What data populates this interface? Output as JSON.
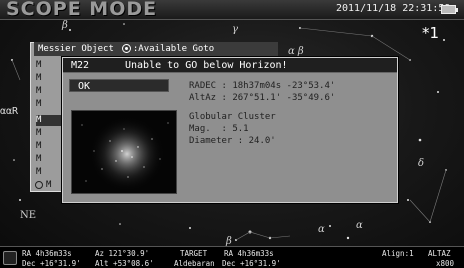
{
  "header": {
    "mode_title": "SCOPE MODE",
    "clock": "2011/11/18 22:31:59"
  },
  "corner_note": "*1",
  "side_marker": "ααR",
  "sky_labels": [
    "β",
    "α β",
    "γ",
    "δ",
    "α",
    "NE",
    "α",
    "β"
  ],
  "list_panel": {
    "title": "Messier Object",
    "goto_hint": ":Available Goto",
    "rows": [
      "M",
      "M",
      "M",
      "M",
      "M",
      "M",
      "M",
      "M",
      "M",
      "M",
      "M"
    ]
  },
  "dialog": {
    "object": "M22",
    "message": "Unable to GO below Horizon!",
    "ok_label": "OK",
    "radec": "RADEC : 18h37m04s -23°53.4'",
    "altaz": "AltAz : 267°51.1' -35°49.6'",
    "type": "Globular Cluster",
    "mag": "Mag.  : 5.1",
    "diameter": "Diameter : 24.0'"
  },
  "footer": {
    "ra_label": "RA  4h36m33s",
    "az_label": "Az 121°30.9'",
    "dec_label": "Dec +16°31.9'",
    "alt_label": "Alt +53°08.6'",
    "target_label": "TARGET",
    "target_name": "Aldebaran",
    "target_ra": "RA  4h36m33s",
    "target_dec": "Dec +16°31.9'",
    "align": "Align:1",
    "view_mode": "ALTAZ",
    "zoom": "x800"
  },
  "colors": {
    "dialog_bg": "#8f8f8f",
    "header_bg": "#1f1f1f",
    "selected_bg": "#333333"
  }
}
